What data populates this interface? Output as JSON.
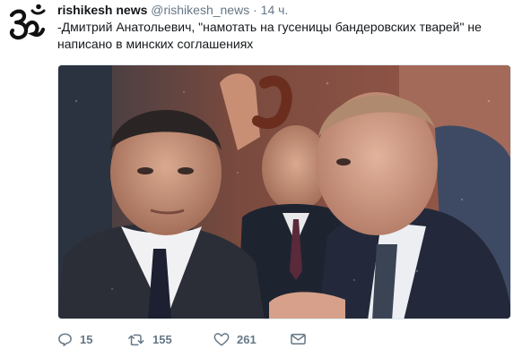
{
  "tweet": {
    "author_name": "rishikesh news",
    "author_handle": "@rishikesh_news",
    "separator": "·",
    "time": "14 ч.",
    "text": "-Дмитрий Анатольевич, \"намотать на гусеницы бандеровских тварей\" не написано в минских соглашениях",
    "avatar_icon": "om-symbol-icon"
  },
  "actions": {
    "reply_count": "15",
    "retweet_count": "155",
    "like_count": "261",
    "reply_icon": "reply-icon",
    "retweet_icon": "retweet-icon",
    "like_icon": "heart-icon",
    "dm_icon": "envelope-icon"
  },
  "colors": {
    "text_primary": "#14171a",
    "text_secondary": "#657786",
    "border": "#e1e8ed"
  }
}
